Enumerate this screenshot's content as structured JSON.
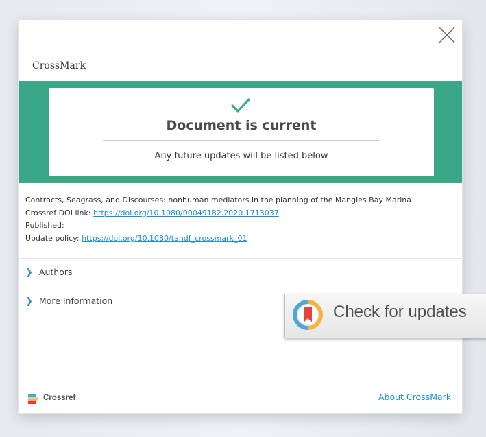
{
  "modal": {
    "brand": "CrossMark",
    "close_icon": "close-icon"
  },
  "status": {
    "icon": "check-icon",
    "title": "Document is current",
    "subtitle": "Any future updates will be listed below",
    "colors": {
      "band": "#3aa887",
      "check": "#3aa887"
    }
  },
  "article": {
    "title": "Contracts, Seagrass, and Discourses: nonhuman mediators in the planning of the Mangles Bay Marina",
    "doi_label": "Crossref DOI link: ",
    "doi_link": "https://doi.org/10.1080/00049182.2020.1713037",
    "published_label": "Published:",
    "policy_label": "Update policy: ",
    "policy_link": "https://doi.org/10.1080/tandf_crossmark_01"
  },
  "sections": [
    {
      "icon": "chevron-right-icon",
      "label": "Authors"
    },
    {
      "icon": "chevron-right-icon",
      "label": "More Information"
    }
  ],
  "badge": {
    "icon": "crossmark-badge-icon",
    "label": "Check for updates"
  },
  "footer": {
    "logo_icon": "crossref-logo-icon",
    "logo_text": "Crossref",
    "about_link": "About CrossMark"
  },
  "colors": {
    "link": "#1a8fd1",
    "chevron": "#2f8fc4"
  }
}
